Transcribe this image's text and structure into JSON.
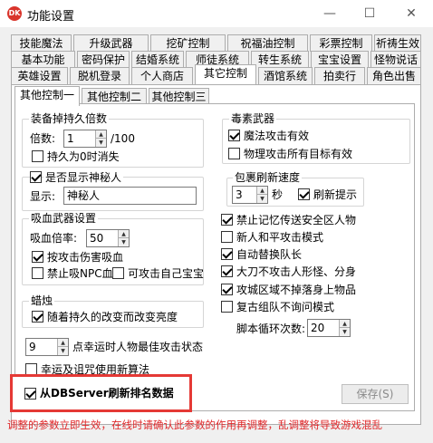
{
  "window": {
    "title": "功能设置",
    "app_icon_text": "DK",
    "minimize_glyph": "—",
    "maximize_glyph": "☐",
    "close_glyph": "✕"
  },
  "tabs": {
    "row1": [
      "技能魔法",
      "升级武器",
      "挖矿控制",
      "祝福油控制",
      "彩票控制",
      "祈祷生效"
    ],
    "row2": [
      "基本功能",
      "密码保护",
      "结婚系统",
      "师徒系统",
      "转生系统",
      "宝宝设置",
      "怪物说话"
    ],
    "row3": [
      "英雄设置",
      "脱机登录",
      "个人商店",
      "其它控制",
      "酒馆系统",
      "拍卖行",
      "角色出售"
    ],
    "active": "其它控制"
  },
  "subtabs": {
    "items": [
      "其他控制一",
      "其他控制二",
      "其他控制三"
    ],
    "active": "其他控制一"
  },
  "equip_durability": {
    "title": "装备掉持久倍数",
    "rate_label": "倍数:",
    "rate_value": "1",
    "rate_suffix": "/100",
    "disappear_label": "持久为0时消失",
    "disappear_checked": false
  },
  "mystery": {
    "show_label": "是否显示神秘人",
    "show_checked": true,
    "display_label": "显示:",
    "display_value": "神秘人"
  },
  "vampire": {
    "title": "吸血武器设置",
    "rate_label": "吸血倍率:",
    "rate_value": "50",
    "by_damage_label": "按攻击伤害吸血",
    "by_damage_checked": true,
    "no_npc_label": "禁止吸NPC血",
    "no_npc_checked": false,
    "self_pet_label": "可攻击自己宝宝",
    "self_pet_checked": false
  },
  "candle": {
    "title": "蜡烛",
    "brightness_label": "随着持久的改变而改变亮度",
    "brightness_checked": true
  },
  "lucky": {
    "value": "9",
    "label": "点幸运时人物最佳攻击状态"
  },
  "partial_label": "幸运及诅咒使用新算法",
  "poison": {
    "title": "毒素武器",
    "magic_label": "魔法攻击有效",
    "magic_checked": true,
    "physical_label": "物理攻击所有目标有效",
    "physical_checked": false
  },
  "bag_refresh": {
    "title": "包裹刷新速度",
    "value": "3",
    "unit": "秒",
    "tip_label": "刷新提示",
    "tip_checked": true
  },
  "options": [
    {
      "label": "禁止记忆传送安全区人物",
      "checked": true
    },
    {
      "label": "新人和平攻击模式",
      "checked": false
    },
    {
      "label": "自动替换队长",
      "checked": true
    },
    {
      "label": "大刀不攻击人形怪、分身",
      "checked": true
    },
    {
      "label": "攻城区域不掉落身上物品",
      "checked": true
    },
    {
      "label": "复古组队不询问模式",
      "checked": false
    }
  ],
  "script_loop": {
    "label": "脚本循环次数:",
    "value": "20"
  },
  "db_refresh": {
    "label": "从DBServer刷新排名数据",
    "checked": true
  },
  "save_label": "保存(S)",
  "footer_message": "调整的参数立即生效，在线时请确认此参数的作用再调整，乱调整将导致游戏混乱",
  "colors": {
    "highlight": "#e53935",
    "footer_text": "#e0282a"
  }
}
